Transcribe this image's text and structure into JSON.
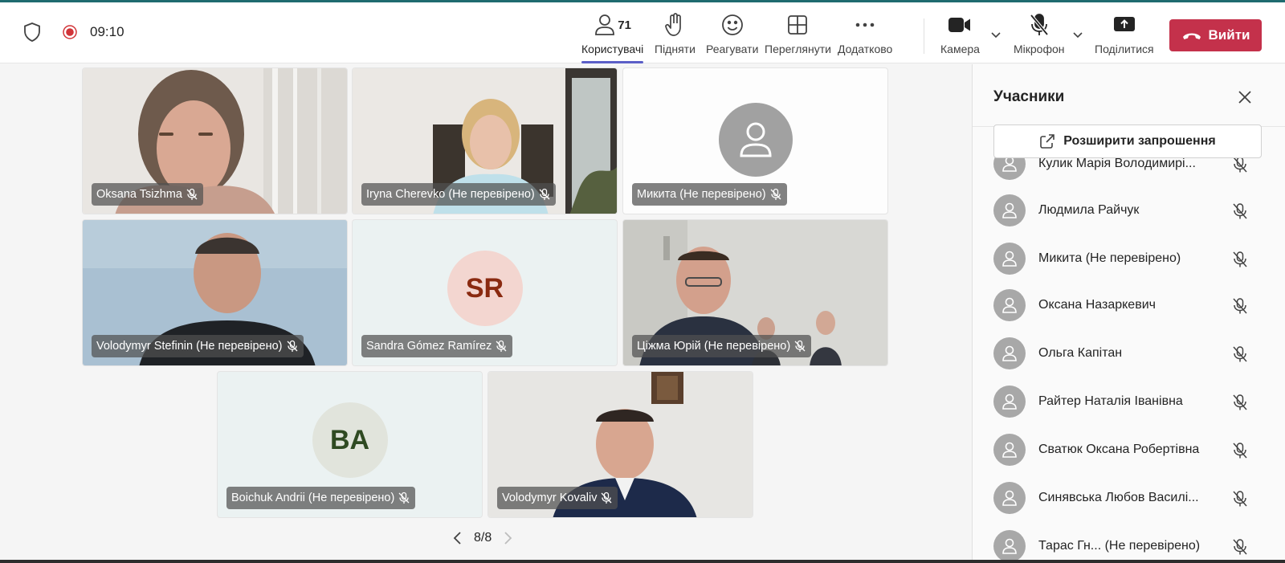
{
  "header": {
    "time": "09:10",
    "people_label": "Користувачі",
    "people_count": "71",
    "raise_label": "Підняти",
    "react_label": "Реагувати",
    "view_label": "Переглянути",
    "more_label": "Додатково",
    "camera_label": "Камера",
    "mic_label": "Мікрофон",
    "share_label": "Поділитися",
    "leave_label": "Вийти"
  },
  "tiles": [
    {
      "name": "Oksana Tsizhma",
      "type": "video"
    },
    {
      "name": "Iryna Cherevko (Не перевірено)",
      "type": "video"
    },
    {
      "name": "Микита (Не перевірено)",
      "type": "avatar"
    },
    {
      "name": "Volodymyr Stefinin (Не перевірено)",
      "type": "video"
    },
    {
      "name": "Sandra Gómez Ramírez",
      "type": "initials",
      "initials": "SR"
    },
    {
      "name": "Ціжма Юрій (Не перевірено)",
      "type": "video"
    },
    {
      "name": "Boichuk Andrii (Не перевірено)",
      "type": "initials",
      "initials": "BA"
    },
    {
      "name": "Volodymyr Kovaliv",
      "type": "video"
    }
  ],
  "pager": {
    "label": "8/8"
  },
  "participants_panel": {
    "title": "Учасники",
    "invite_label": "Розширити запрошення",
    "items": [
      "Кулик Марія Володимирі...",
      "Людмила Райчук",
      "Микита (Не перевірено)",
      "Оксана Назаркевич",
      "Ольга Капітан",
      "Райтер Наталія Іванівна",
      "Сватюк Оксана Робертівна",
      "Синявська Любов Василі...",
      "Тарас Гн... (Не перевірено)"
    ]
  },
  "colors": {
    "accent": "#5b5fc7",
    "leave": "#c4314b",
    "recording": "#d13438",
    "sr_bg": "#f3d6d0",
    "sr_fg": "#8a2a10",
    "ba_bg": "#e1e4dc",
    "ba_fg": "#2f4a22"
  }
}
